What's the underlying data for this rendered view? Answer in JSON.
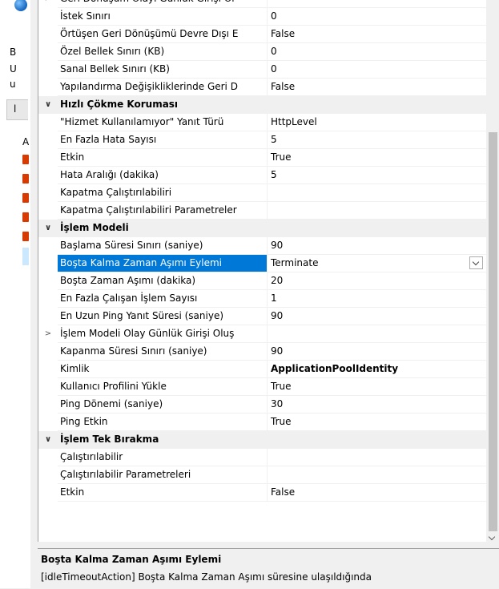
{
  "background_window": {
    "letters": [
      "B",
      "U",
      "u"
    ],
    "tab_label": "l",
    "row_letter": "A"
  },
  "properties": [
    {
      "type": "prop",
      "expander": ">",
      "name": "Geri Dönüşüm Olayı Günlük Girişi Ol",
      "value": ""
    },
    {
      "type": "prop",
      "name": "İstek Sınırı",
      "value": "0"
    },
    {
      "type": "prop",
      "name": "Örtüşen Geri Dönüşümü Devre Dışı E",
      "value": "False"
    },
    {
      "type": "prop",
      "name": "Özel Bellek Sınırı (KB)",
      "value": "0"
    },
    {
      "type": "prop",
      "name": "Sanal Bellek Sınırı (KB)",
      "value": "0"
    },
    {
      "type": "prop",
      "name": "Yapılandırma Değişikliklerinde Geri D",
      "value": "False"
    },
    {
      "type": "cat",
      "expander": "∨",
      "name": "Hızlı Çökme Koruması"
    },
    {
      "type": "prop",
      "name": "\"Hizmet Kullanılamıyor\" Yanıt Türü",
      "value": "HttpLevel"
    },
    {
      "type": "prop",
      "name": "En Fazla Hata Sayısı",
      "value": "5"
    },
    {
      "type": "prop",
      "name": "Etkin",
      "value": "True"
    },
    {
      "type": "prop",
      "name": "Hata Aralığı (dakika)",
      "value": "5"
    },
    {
      "type": "prop",
      "name": "Kapatma Çalıştırılabiliri",
      "value": ""
    },
    {
      "type": "prop",
      "name": "Kapatma Çalıştırılabiliri Parametreler",
      "value": ""
    },
    {
      "type": "cat",
      "expander": "∨",
      "name": "İşlem Modeli"
    },
    {
      "type": "prop",
      "name": "Başlama Süresi Sınırı (saniye)",
      "value": "90"
    },
    {
      "type": "prop",
      "name": "Boşta Kalma Zaman Aşımı Eylemi",
      "value": "Terminate",
      "selected": true,
      "dropdown": true
    },
    {
      "type": "prop",
      "name": "Boşta Zaman Aşımı (dakika)",
      "value": "20"
    },
    {
      "type": "prop",
      "name": "En Fazla Çalışan İşlem Sayısı",
      "value": "1"
    },
    {
      "type": "prop",
      "name": "En Uzun Ping Yanıt Süresi (saniye)",
      "value": "90"
    },
    {
      "type": "prop",
      "expander": ">",
      "name": "İşlem Modeli Olay Günlük Girişi Oluş",
      "value": ""
    },
    {
      "type": "prop",
      "name": "Kapanma Süresi Sınırı (saniye)",
      "value": "90"
    },
    {
      "type": "prop",
      "name": "Kimlik",
      "value": "ApplicationPoolIdentity",
      "bold_value": true
    },
    {
      "type": "prop",
      "name": "Kullanıcı Profilini Yükle",
      "value": "True"
    },
    {
      "type": "prop",
      "name": "Ping Dönemi (saniye)",
      "value": "30"
    },
    {
      "type": "prop",
      "name": "Ping Etkin",
      "value": "True"
    },
    {
      "type": "cat",
      "expander": "∨",
      "name": "İşlem Tek Bırakma"
    },
    {
      "type": "prop",
      "name": "Çalıştırılabilir",
      "value": ""
    },
    {
      "type": "prop",
      "name": "Çalıştırılabilir Parametreleri",
      "value": ""
    },
    {
      "type": "prop",
      "name": "Etkin",
      "value": "False"
    }
  ],
  "description": {
    "title": "Boşta Kalma Zaman Aşımı Eylemi",
    "body": "[idleTimeoutAction] Boşta Kalma Zaman Aşımı süresine ulaşıldığında"
  }
}
